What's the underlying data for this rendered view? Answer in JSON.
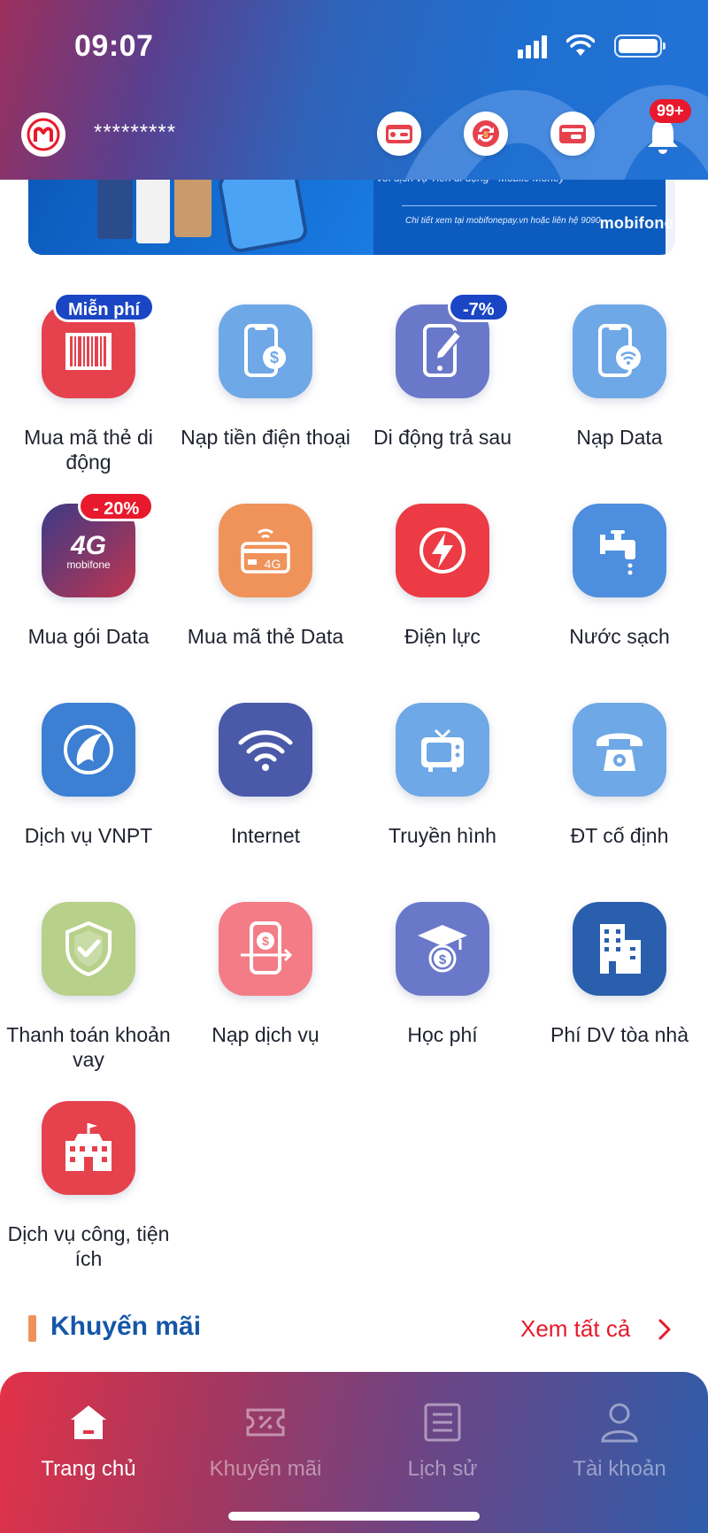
{
  "status_bar": {
    "time": "09:07"
  },
  "header": {
    "masked_phone": "*********",
    "notification_count": "99+"
  },
  "banner": {
    "line1": "với dịch vụ Tiền di động - Mobile Money",
    "note": "Chi tiết xem tại mobifonepay.vn hoặc liên hệ 9090",
    "brand": "mobifone"
  },
  "services": [
    {
      "label": "Mua mã thẻ di động",
      "badge": "Miễn phí",
      "badge_color": "#1a45c4",
      "icon": "barcode-icon",
      "color": "#e5424d"
    },
    {
      "label": "Nạp tiền điện thoại",
      "badge": "",
      "icon": "phone-money-icon",
      "color": "#6fa8e6"
    },
    {
      "label": "Di động trả sau",
      "badge": "-7%",
      "badge_color": "#1a45c4",
      "icon": "phone-edit-icon",
      "color": "#6a78c9"
    },
    {
      "label": "Nạp Data",
      "badge": "",
      "icon": "phone-wifi-icon",
      "color": "#6fa8e6"
    },
    {
      "label": "Mua gói Data",
      "badge": "- 20%",
      "badge_color": "#e8192c",
      "icon": "4g-icon",
      "color": "#c0354f"
    },
    {
      "label": "Mua mã thẻ Data",
      "badge": "",
      "icon": "data-card-icon",
      "color": "#f0935a"
    },
    {
      "label": "Điện lực",
      "badge": "",
      "icon": "lightning-icon",
      "color": "#ec3b44"
    },
    {
      "label": "Nước sạch",
      "badge": "",
      "icon": "water-tap-icon",
      "color": "#4d8fde"
    },
    {
      "label": "Dịch vụ VNPT",
      "badge": "",
      "icon": "vnpt-icon",
      "color": "#3c7fd3"
    },
    {
      "label": "Internet",
      "badge": "",
      "icon": "wifi-icon",
      "color": "#4a5aa8"
    },
    {
      "label": "Truyền hình",
      "badge": "",
      "icon": "tv-icon",
      "color": "#6fa8e6"
    },
    {
      "label": "ĐT cố định",
      "badge": "",
      "icon": "landline-phone-icon",
      "color": "#6fa8e6"
    },
    {
      "label": "Thanh toán khoản vay",
      "badge": "",
      "icon": "shield-check-icon",
      "color": "#b7d08a"
    },
    {
      "label": "Nạp dịch vụ",
      "badge": "",
      "icon": "phone-transfer-icon",
      "color": "#f37c86"
    },
    {
      "label": "Học phí",
      "badge": "",
      "icon": "graduation-cap-icon",
      "color": "#6a78c9"
    },
    {
      "label": "Phí DV tòa nhà",
      "badge": "",
      "icon": "building-icon",
      "color": "#2a5fae"
    },
    {
      "label": "Dịch vụ công, tiện ích",
      "badge": "",
      "icon": "public-building-icon",
      "color": "#e5424d"
    }
  ],
  "promotions": {
    "title": "Khuyến mãi",
    "see_all": "Xem tất cả"
  },
  "bottom_nav": [
    {
      "label": "Trang chủ",
      "icon": "home-icon",
      "active": true
    },
    {
      "label": "Khuyến mãi",
      "icon": "voucher-icon",
      "active": false
    },
    {
      "label": "Lịch sử",
      "icon": "history-list-icon",
      "active": false
    },
    {
      "label": "Tài khoản",
      "icon": "user-icon",
      "active": false
    }
  ]
}
